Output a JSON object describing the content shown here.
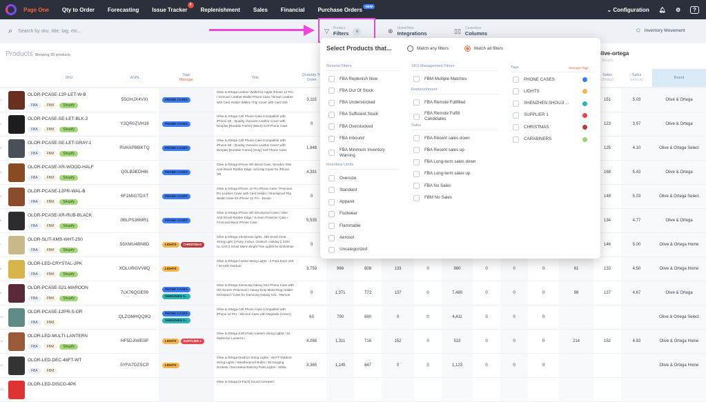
{
  "nav": {
    "items": [
      "Page One",
      "Qty to Order",
      "Forecasting",
      "Issue Tracker",
      "Replenishment",
      "Sales",
      "Financial",
      "Purchase Orders"
    ],
    "issue_badge": "9",
    "new_badge": "NEW",
    "configuration": "Configuration"
  },
  "toolbar": {
    "search_placeholder": "Search by sku, title, tag, etc...",
    "filters_small": "Product",
    "filters_label": "Filters",
    "filters_count": "0",
    "integrations_small": "Show/Hide",
    "integrations_label": "Integrations",
    "columns_small": "Customize",
    "columns_label": "Columns",
    "inventory_movement": "Inventory Movement"
  },
  "products": {
    "title": "Products",
    "showing": "Showing 26 products",
    "group_name": "olive-ortega",
    "group_sub": "Shopify"
  },
  "columns": {
    "sku": "SKU",
    "asin": "ASIN",
    "tags": "Tags",
    "tags_manage": "Manage",
    "title": "Title",
    "qty": "Quantity To Order",
    "sales30": "Sales",
    "sales30_sub": "(30day)",
    "velocity": "Sales",
    "velocity_sub": "Velocity",
    "brand": "Brand"
  },
  "tag_colors": {
    "PHONE CASES": "#3b7cf5",
    "LIGHTS": "#f5b54a",
    "SHENZHEN S...": "#2bb5b8",
    "SUPPLIER 1": "#ef4050",
    "CHRISTMAS": "#c0393b"
  },
  "rows": [
    {
      "n": "1",
      "sku": "OLOR-PCASE-12P-LET-W-B",
      "asin": "55GHJX4VXI",
      "tags": [
        "PHONE CASES"
      ],
      "ch": [
        "FBA",
        "FBM",
        "Shopify"
      ],
      "title": "Olive & Ortega Leather Wallet for Apple iPhone 12 Pro / Genuine Leather Wallet Phone Case / Brown Leather with Card Holder Wallet / Flip Cover with Card Slot",
      "vals": [
        "3,115",
        null,
        null,
        null,
        null,
        null,
        null,
        null,
        null,
        null,
        "151",
        "5.03"
      ],
      "brand": "Olive & Ortega",
      "img": "#6b2f22"
    },
    {
      "n": "2",
      "sku": "OLOR-PCASE-SE-LET-BLK-2",
      "asin": "Y2QR0ZVH16",
      "tags": [
        "PHONE CASES"
      ],
      "ch": [
        "FBA",
        "FBM",
        "Shopify"
      ],
      "title": "Olive & Ortega Cell Phone Case Compatible with iPhone SE - Quality, Genuine Leather Cover with Dimples [Durable Frame] (Black) Cell Phone Case",
      "vals": [
        "0",
        null,
        null,
        null,
        null,
        null,
        null,
        null,
        null,
        null,
        "123",
        "3.97"
      ],
      "brand": "Olive & Ortega",
      "img": "#1d1d1f"
    },
    {
      "n": "3",
      "sku": "OLOR-PCASE-SE-LET-GRAY-1",
      "asin": "RVASPBBKTQ",
      "tags": [
        "PHONE CASES"
      ],
      "ch": [
        "FBA",
        "FBM",
        "Shopify"
      ],
      "title": "Olive & Ortega Cell Phone Case Compatible with iPhone SE - Quality, Genuine Leather Cover with Dimples [Durable Frame] (Gray) Cell Phone Case",
      "vals": [
        "1,948",
        null,
        null,
        null,
        null,
        null,
        null,
        null,
        null,
        null,
        "125",
        "4.10"
      ],
      "brand": "Olive & Ortega Select",
      "img": "#4a5058"
    },
    {
      "n": "4",
      "sku": "OLOR-PCASE-XR-WOOD-HALF",
      "asin": "Q0LB3EDH6I",
      "tags": [
        "PHONE CASES"
      ],
      "ch": [
        "FBA",
        "FBM",
        "Shopify"
      ],
      "title": "Olive & Ortega iPhone XR Wood Case, Wooden Slim Anti-Shock Rubber Edge, Anti-slip Cover for iPhone XR",
      "vals": [
        "4,391",
        null,
        null,
        null,
        null,
        null,
        null,
        null,
        null,
        null,
        "168",
        "5.43"
      ],
      "brand": "Olive & Ortega",
      "img": "#8a4a22"
    },
    {
      "n": "5",
      "sku": "OLOR-PCASE-12PR-WAL-B",
      "asin": "6F1MIG7DXT",
      "tags": [
        "PHONE CASES"
      ],
      "ch": [
        "FBA",
        "FBM",
        "Shopify"
      ],
      "title": "Olive & Ortega iPhone 12 Pro Phone Case / Premium PU Leather Cover with Card Holder / Shockproof Flip Wallet Case for iPhone 12 Pro - Brown",
      "vals": [
        "0",
        null,
        null,
        null,
        null,
        null,
        null,
        null,
        null,
        null,
        "149",
        "5.03"
      ],
      "brand": "Olive & Ortega Select",
      "img": "#8b4a2a"
    },
    {
      "n": "6",
      "sku": "OLOR-PCASE-XR-RUB-BLACK",
      "asin": "0BLPS36MR1",
      "tags": [
        "PHONE CASES"
      ],
      "ch": [
        "FBA",
        "FBM",
        "Shopify"
      ],
      "title": "Olive & Ortega iPhone XR Shockproof Case / Slim Anti-Shock Rubber Edge / Screen Protector Case / Front and Back iPhone Case",
      "vals": [
        "5,535",
        null,
        null,
        null,
        null,
        null,
        null,
        null,
        null,
        null,
        "134",
        "4.77"
      ],
      "brand": "Olive & Ortega",
      "img": "#2c2c30"
    },
    {
      "n": "7",
      "sku": "OLOR-SLIT-XMS-WHT-250",
      "asin": "53XMU4BN8D",
      "tags": [
        "LIGHTS",
        "CHRISTMAS"
      ],
      "ch": [
        "FBA",
        "FBM",
        "Shopify"
      ],
      "title": "Olive & Ortega Christmas Lights, 250 Small Clear String Light || Party, Indoor, Outdoor, Holiday || 120V UL Cert || Xmas Warm Bright Tree Lights for Christmas",
      "vals": [
        "0",
        null,
        null,
        null,
        null,
        null,
        null,
        null,
        null,
        null,
        "146",
        "5.00"
      ],
      "brand": "Olive & Ortega Home",
      "img": "#c9b98a"
    },
    {
      "n": "8",
      "sku": "OLOR-LED-CRYSTAL-2PK",
      "asin": "XOLURGVV8Q",
      "tags": [
        "LIGHTS"
      ],
      "ch": [
        "FBA",
        "FBM",
        "Shopify"
      ],
      "title": "Olive & Ortega Crystal String Lights - 2 Pack Each 21ft / 30 LED Outdoor",
      "vals": [
        "3,759",
        "966",
        "808",
        "133",
        "0",
        "980",
        "0",
        "0",
        "0",
        "61",
        "133",
        "4.50"
      ],
      "brand": "Olive & Ortega Home",
      "img": "#d8b54a"
    },
    {
      "n": "9",
      "sku": "OLOR-PCASE-S21-MAROON",
      "asin": "7LK76QGE99",
      "tags": [
        "PHONE CASES",
        "SHENZHEN S..."
      ],
      "ch": [
        "FBA",
        "FBM",
        "Shopify"
      ],
      "title": "Olive & Ortega Samsung Galaxy S21 Phone Case with HD Screen Protectors / Heavy Duty Metal Ring Holder Kickstand / Case for Samsung Galaxy S21 - Maroon",
      "vals": [
        "0",
        "1,371",
        "773",
        "137",
        "0",
        "7,480",
        "0",
        "0",
        "0",
        "98",
        "137",
        "4.67"
      ],
      "brand": "Olive & Ortega",
      "img": "#5a2a3a"
    },
    {
      "n": "10",
      "sku": "OLOR-PCASE-12PR-S-GR",
      "asin": "QLZOMHQQ9O",
      "tags": [
        "PHONE CASES",
        "SHENZHEN S..."
      ],
      "ch": [
        "FBA",
        "FBM"
      ],
      "title": "Olive & Ortega Cell Phone Case Compatible with iPhone 12 Pro - Silicone Case with MagSafe (Green)",
      "vals": [
        "63",
        "790",
        "880",
        "0",
        "0",
        "4,411",
        "0",
        "0",
        "0",
        "",
        "",
        ""
      ],
      "brand": "Olive & Ortega Select",
      "img": "#5f8a86"
    },
    {
      "n": "11",
      "sku": "OLOR-LED-MULTI-LANTERN",
      "asin": "HF5DJIWE5P",
      "tags": [
        "LIGHTS",
        "SUPPLIER 1"
      ],
      "ch": [
        "FBA",
        "FBM",
        "Shopify"
      ],
      "title": "Olive & Ortega 8.6Ft Patio Lantern String Lights / 10 Multicolor Lanterns /",
      "vals": [
        "4,088",
        "1,311",
        "716",
        "152",
        "0",
        "522",
        "0",
        "0",
        "0",
        "214",
        "152",
        "4.83"
      ],
      "brand": "Olive & Ortega Home",
      "img": "#9a5a3a"
    },
    {
      "n": "12",
      "sku": "OLOR-LED-DEC-48FT-WT",
      "asin": "5YFA7DZSCP",
      "tags": [
        "LIGHTS"
      ],
      "ch": [
        "FBA",
        "FBM"
      ],
      "title": "Olive & Ortega Outdoor String Lights - 48 FT Outdoor String Lights / Weatherproof Bulbs / 15 Hanging Sockets / Decorative Balcony Patio Lights - White",
      "vals": [
        "3,365",
        "1,145",
        "847",
        "0",
        "0",
        "1,123",
        "0",
        "0",
        "0",
        "",
        "",
        ""
      ],
      "brand": "Olive & Ortega Home",
      "img": "#333"
    },
    {
      "n": "13",
      "sku": "OLOR-LED-DISCO-4PK",
      "asin": "",
      "tags": [],
      "ch": [],
      "title": "Olive & Ortega [4-Pack] Sound Activated",
      "vals": [
        "",
        "",
        "",
        "",
        "",
        "",
        "",
        "",
        "",
        "",
        "",
        ""
      ],
      "brand": "",
      "img": "#d33"
    }
  ],
  "dropdown": {
    "title": "Select Products that...",
    "match_any": "Match any filters",
    "match_all": "Match all filters",
    "general_title": "General Filters",
    "general": [
      "FBA Replenish Now",
      "FBA Out Of Stock",
      "FBA Understocked",
      "FBA Sufficient Stock",
      "FBA Overstocked",
      "FBA Inbound",
      "FBA Minimum Inventory Warning"
    ],
    "inv_title": "Inventory Limits",
    "inventory": [
      "Oversize",
      "Standard",
      "Apparel",
      "Footwear",
      "Flammable",
      "Aerosol",
      "Uncategorized"
    ],
    "sku_title": "SKU Management Filters",
    "sku": [
      "FBM Multiple Matches"
    ],
    "repl_title": "Replenishment",
    "replenishment": [
      "FBA Remote Fullfilled",
      "FBA Remote Fulfill Candidates"
    ],
    "sales_title": "Sales",
    "sales": [
      "FBA Recent sales down",
      "FBA Recent sales up",
      "FBA Long-term sales down",
      "FBA Long-term sales up",
      "FBA No Sales",
      "FBM No Sales"
    ],
    "tags_title": "Tags",
    "manage_tags": "Manage Tags",
    "tags": [
      {
        "label": "PHONE CASES",
        "color": "#3b7cf5"
      },
      {
        "label": "LIGHTS",
        "color": "#f5b54a"
      },
      {
        "label": "SHENZHEN SHOUJI ...",
        "color": "#2bb5b8"
      },
      {
        "label": "SUPPLIER 1",
        "color": "#ef4050"
      },
      {
        "label": "CHRISTMAS",
        "color": "#c0393b"
      },
      {
        "label": "CARABINERS",
        "color": "#9fd36f"
      }
    ]
  }
}
